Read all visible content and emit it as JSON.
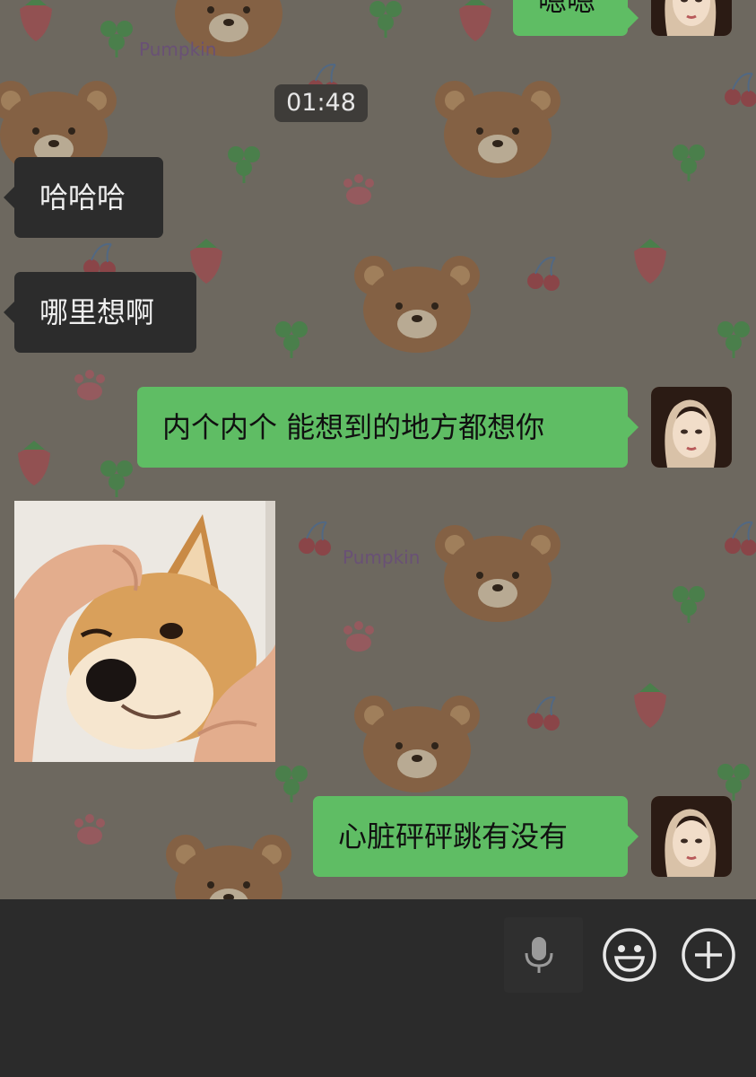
{
  "chat": {
    "timestamp": "01:48",
    "wallpaper_text": "Pumpkin",
    "messages": [
      {
        "side": "out",
        "text": "嗯嗯"
      },
      {
        "side": "in",
        "text": "哈哈哈"
      },
      {
        "side": "in",
        "text": "哪里想啊"
      },
      {
        "side": "out",
        "text": "内个内个 能想到的地方都想你"
      },
      {
        "side": "in",
        "type": "sticker",
        "description": "shiba-dog-sticker"
      },
      {
        "side": "out",
        "text": "心脏砰砰跳有没有"
      }
    ]
  },
  "input_bar": {
    "icons": [
      "microphone-icon",
      "emoji-icon",
      "plus-icon"
    ]
  },
  "colors": {
    "outgoing_bubble": "#5fbd64",
    "incoming_bubble": "#2c2c2c",
    "input_bar": "#2b2b2b"
  }
}
